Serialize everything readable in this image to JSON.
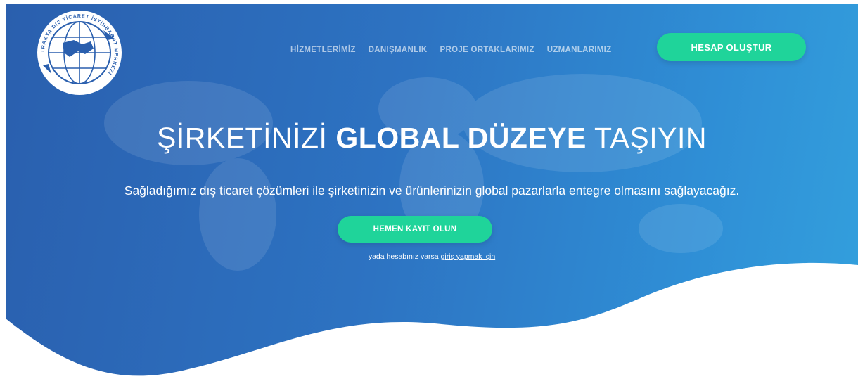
{
  "logo": {
    "ring_text": "TRAKYA DIŞ TİCARET İSTİHBARAT MERKEZİ",
    "icon": "globe-logo-icon"
  },
  "nav": {
    "items": [
      "HİZMETLERİMİZ",
      "DANIŞMANLIK",
      "PROJE ORTAKLARIMIZ",
      "UZMANLARIMIZ"
    ]
  },
  "header": {
    "create_account": "HESAP OLUŞTUR"
  },
  "hero": {
    "headline_part1": "ŞİRKETİNİZİ",
    "headline_part2": "GLOBAL DÜZEYE",
    "headline_part3": "TAŞIYIN",
    "subtitle": "Sağladığımız dış ticaret çözümleri ile şirketinizin ve ürünlerinizin global pazarlarla entegre olmasını sağlayacağız.",
    "register_button": "HEMEN KAYIT OLUN",
    "login_prefix": "yada hesabınız varsa",
    "login_link": "giriş yapmak için"
  },
  "colors": {
    "accent": "#1fd49a",
    "hero_start": "#2a5fae",
    "hero_end": "#33a0dd"
  }
}
